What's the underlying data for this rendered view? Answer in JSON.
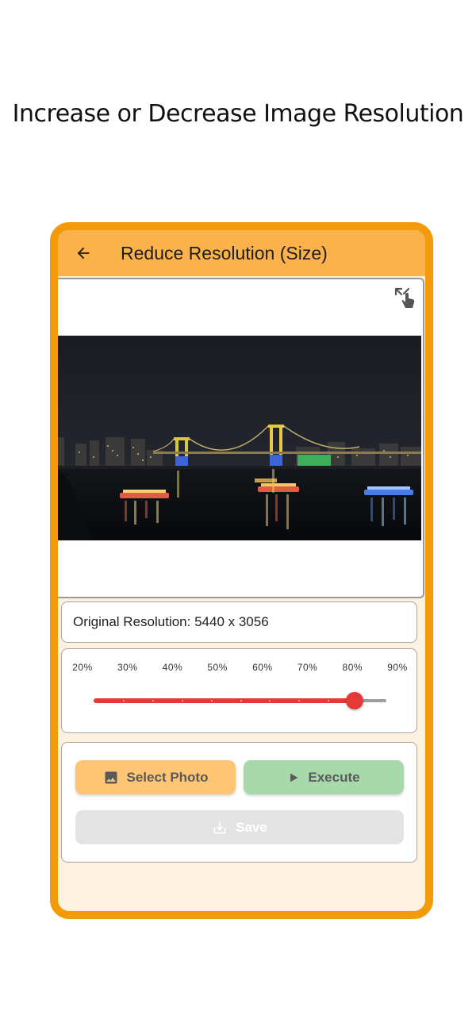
{
  "headline": "Increase or Decrease Image Resolution",
  "appbar": {
    "title": "Reduce Resolution (Size)",
    "back_icon": "arrow-left-icon",
    "color": "#fbb24a"
  },
  "frame_color": "#f39a0a",
  "image_viewer": {
    "expand_icon": "expand-tap-icon"
  },
  "info": {
    "original_resolution": "Original Resolution: 5440 x 3056"
  },
  "slider": {
    "ticks": [
      "20%",
      "30%",
      "40%",
      "50%",
      "60%",
      "70%",
      "80%",
      "90%"
    ],
    "min": 0.2,
    "max": 0.9,
    "value": 0.8,
    "divisions": 10,
    "active_color": "#e53935",
    "inactive_color": "#9e9e9e"
  },
  "actions": {
    "select_photo_label": "Select Photo",
    "select_photo_icon": "image-icon",
    "execute_label": "Execute",
    "execute_icon": "play-icon",
    "save_label": "Save",
    "save_icon": "download-icon",
    "select_color": "#fdc574",
    "execute_color": "#a8d9ab",
    "save_color": "#e3e3e3"
  }
}
